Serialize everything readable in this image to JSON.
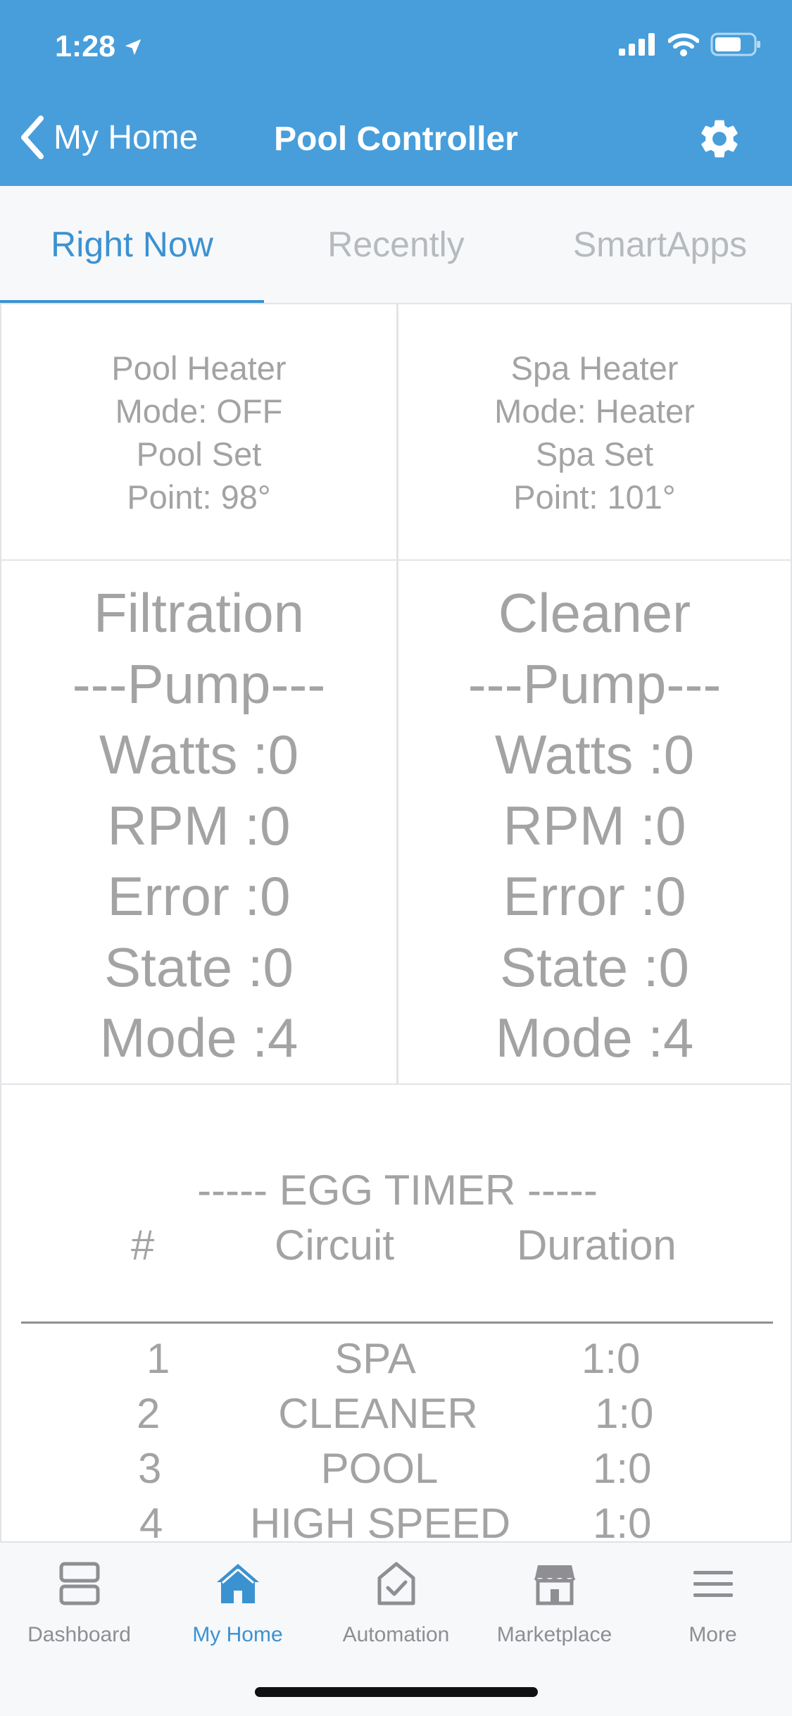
{
  "status": {
    "time": "1:28"
  },
  "nav": {
    "back_label": "My Home",
    "title": "Pool Controller"
  },
  "tabs": [
    {
      "label": "Right Now",
      "active": true
    },
    {
      "label": "Recently",
      "active": false
    },
    {
      "label": "SmartApps",
      "active": false
    }
  ],
  "tiles": {
    "pool_heater": [
      "Pool Heater",
      "Mode: OFF",
      "Pool Set",
      "Point: 98°"
    ],
    "spa_heater": [
      "Spa Heater",
      "Mode: Heater",
      "Spa Set",
      "Point: 101°"
    ],
    "filtration_pump": [
      "Filtration",
      "---Pump---",
      "Watts :0",
      "RPM :0",
      "Error :0",
      "State :0",
      "Mode :4"
    ],
    "cleaner_pump": [
      "Cleaner",
      "---Pump---",
      "Watts :0",
      "RPM :0",
      "Error :0",
      "State :0",
      "Mode :4"
    ]
  },
  "egg_timer": {
    "title": "----- EGG TIMER -----",
    "headers": {
      "num": "#",
      "circuit": "Circuit",
      "duration": "Duration"
    },
    "rows": [
      {
        "num": "1",
        "circuit": "SPA",
        "duration": "1:0"
      },
      {
        "num": "2",
        "circuit": "CLEANER",
        "duration": "1:0"
      },
      {
        "num": "3",
        "circuit": "POOL",
        "duration": "1:0"
      },
      {
        "num": "4",
        "circuit": "HIGH SPEED",
        "duration": "1:0"
      }
    ]
  },
  "bottom_nav": [
    {
      "label": "Dashboard",
      "icon": "dashboard-icon",
      "active": false
    },
    {
      "label": "My Home",
      "icon": "home-icon",
      "active": true
    },
    {
      "label": "Automation",
      "icon": "automation-icon",
      "active": false
    },
    {
      "label": "Marketplace",
      "icon": "marketplace-icon",
      "active": false
    },
    {
      "label": "More",
      "icon": "menu-icon",
      "active": false
    }
  ],
  "colors": {
    "header": "#479edb",
    "accent": "#3b92d1",
    "tile_text": "#a3a3a3",
    "inactive_tab": "#b6babf"
  }
}
